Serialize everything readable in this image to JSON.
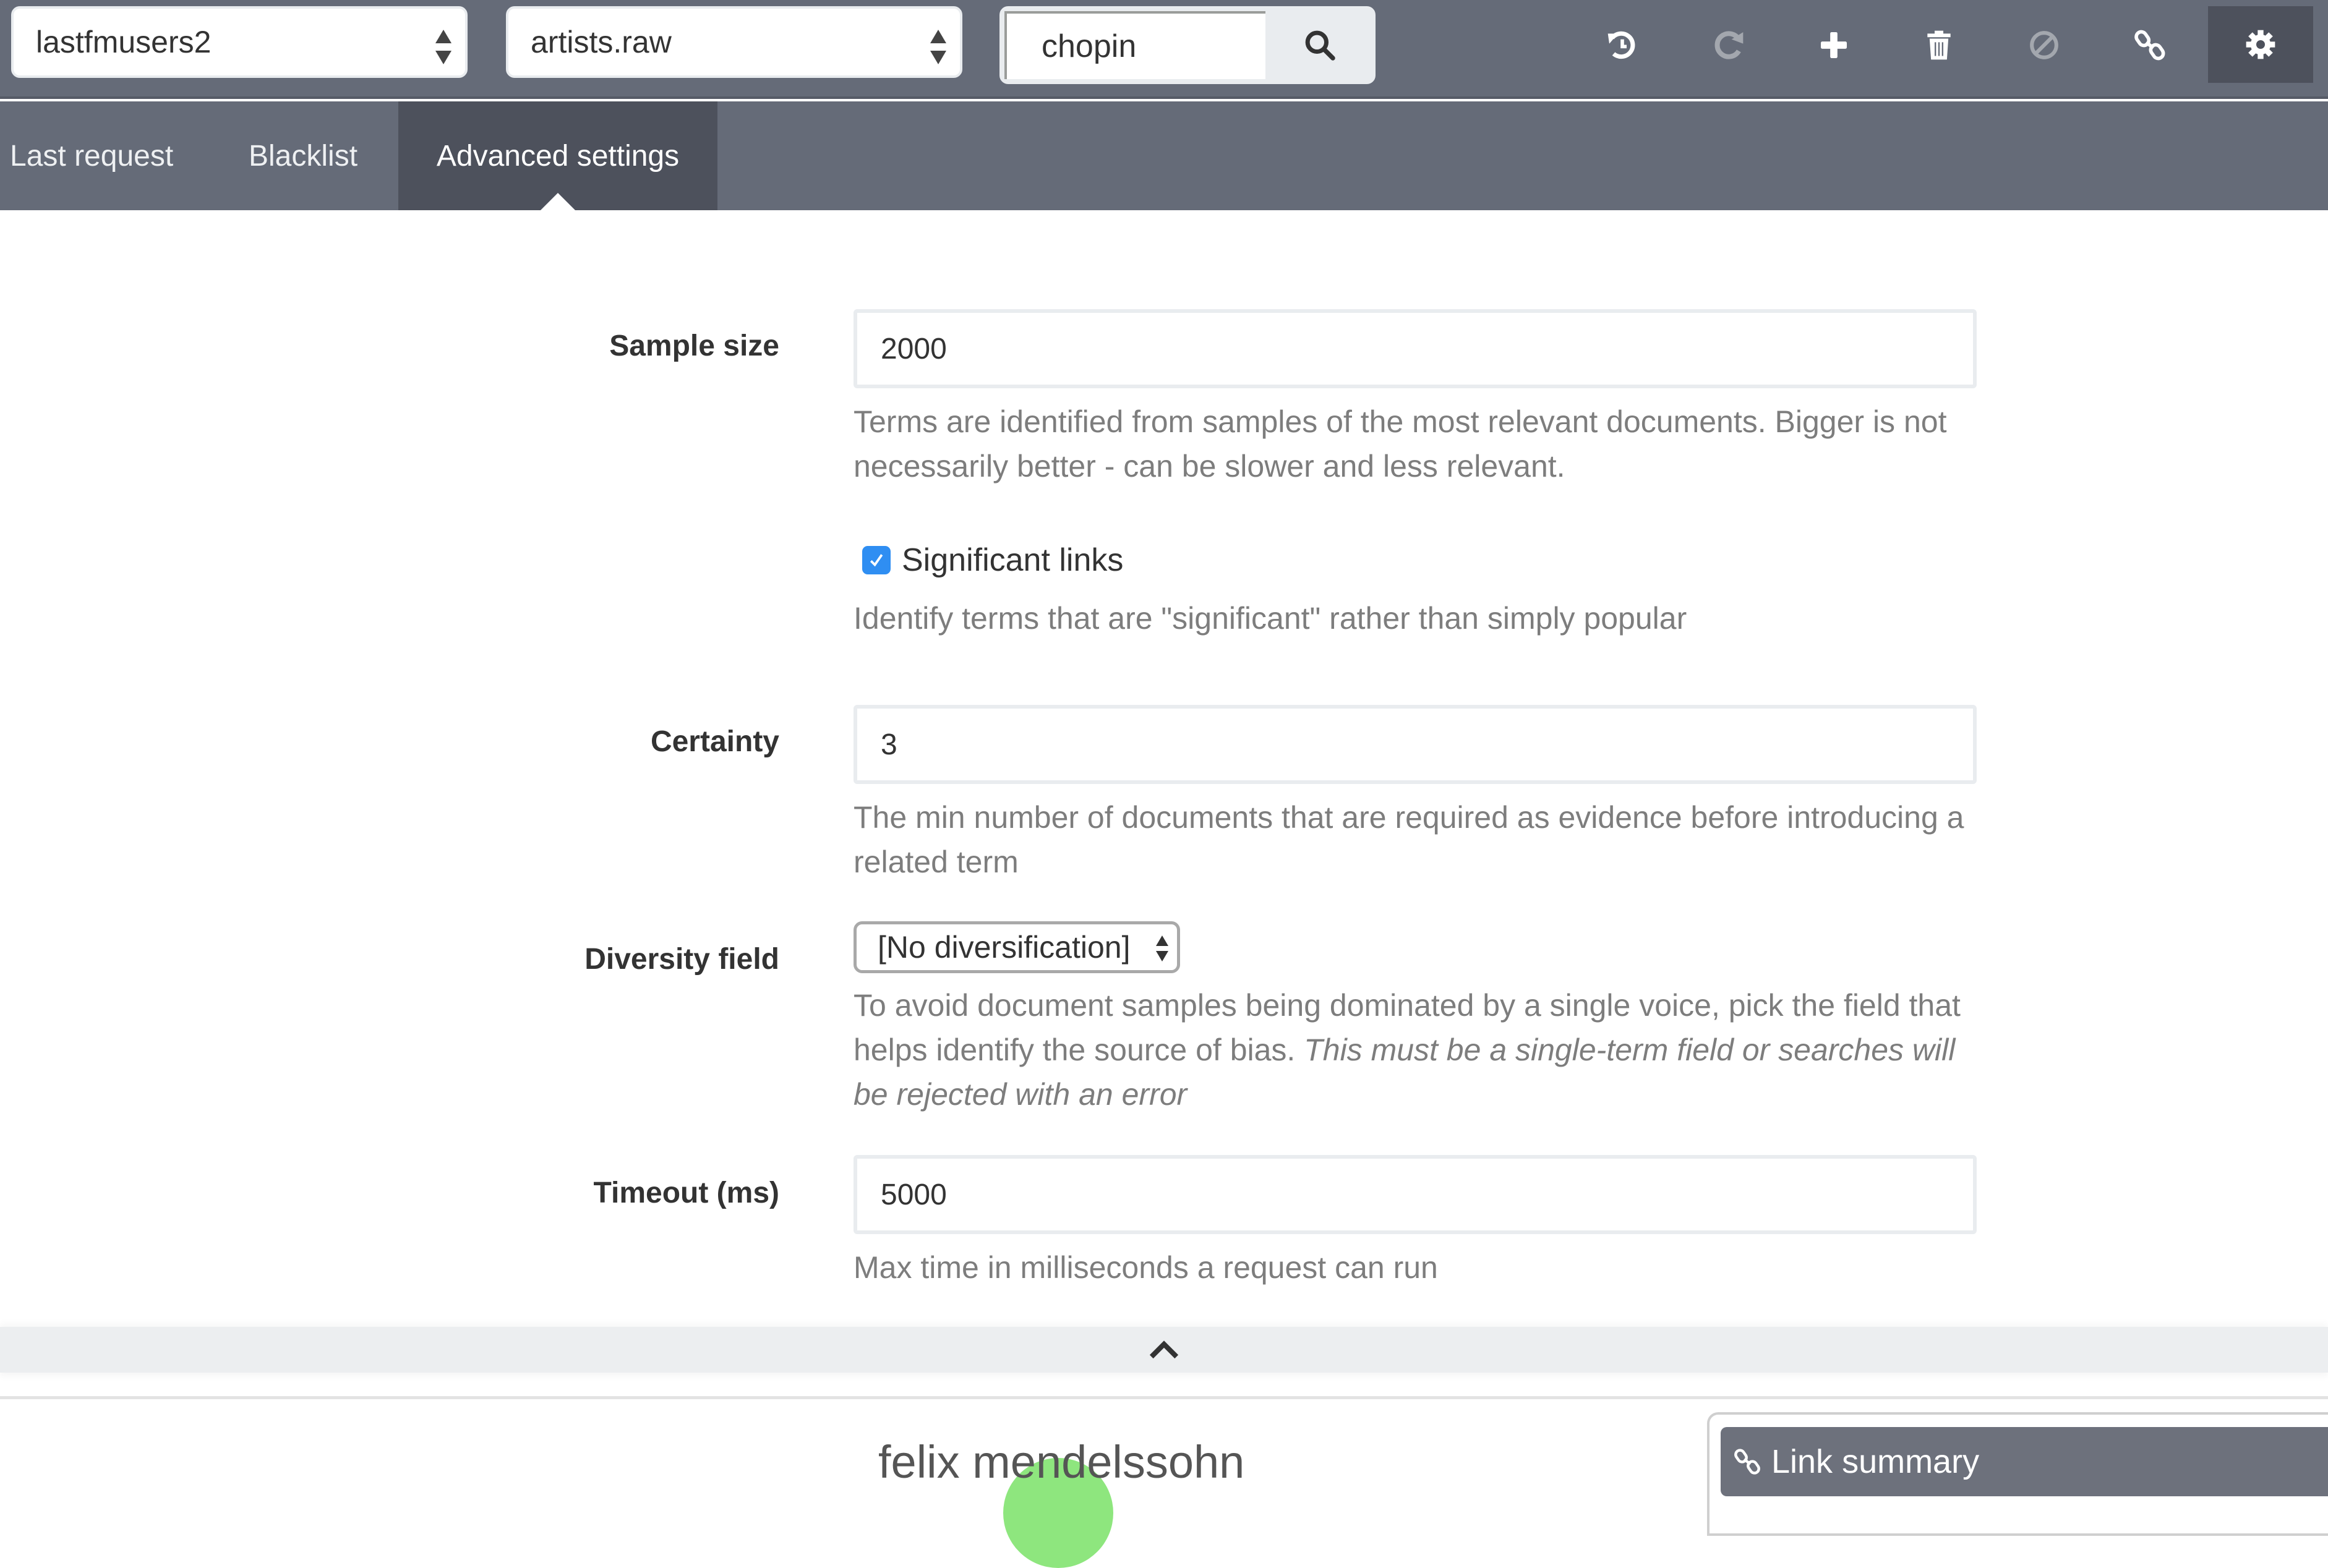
{
  "toolbar": {
    "index_select": {
      "value": "lastfmusers2"
    },
    "field_select": {
      "value": "artists.raw"
    },
    "search": {
      "value": "chopin",
      "icon": "search-icon"
    },
    "actions": [
      {
        "name": "undo",
        "icon": "history-icon",
        "enabled": true
      },
      {
        "name": "redo",
        "icon": "redo-icon",
        "enabled": false
      },
      {
        "name": "add",
        "icon": "plus-icon",
        "enabled": true
      },
      {
        "name": "delete",
        "icon": "trash-icon",
        "enabled": true
      },
      {
        "name": "blacklist",
        "icon": "ban-icon",
        "enabled": false
      },
      {
        "name": "link",
        "icon": "link-icon",
        "enabled": true
      },
      {
        "name": "settings",
        "icon": "gear-icon",
        "enabled": true,
        "active": true
      }
    ]
  },
  "tabs": [
    {
      "label": "Last request",
      "active": false
    },
    {
      "label": "Blacklist",
      "active": false
    },
    {
      "label": "Advanced settings",
      "active": true
    }
  ],
  "settings": {
    "sample_size": {
      "label": "Sample size",
      "value": "2000",
      "help": "Terms are identified from samples of the most relevant documents. Bigger is not necessarily better - can be slower and less relevant."
    },
    "significant_links": {
      "label": "Significant links",
      "checked": true,
      "help": "Identify terms that are \"significant\" rather than simply popular"
    },
    "certainty": {
      "label": "Certainty",
      "value": "3",
      "help": "The min number of documents that are required as evidence before introducing a related term"
    },
    "diversity_field": {
      "label": "Diversity field",
      "value": "[No diversification]",
      "help": "To avoid document samples being dominated by a single voice, pick the field that helps identify the source of bias.",
      "help_italic": "This must be a single-term field or searches will be rejected with an error"
    },
    "timeout": {
      "label": "Timeout (ms)",
      "value": "5000",
      "help": "Max time in milliseconds a request can run"
    }
  },
  "collapse": {
    "icon": "chevron-up-icon"
  },
  "graph": {
    "node_label": "felix mendelssohn",
    "node_color": "#8ee67e"
  },
  "link_summary": {
    "title": "Link summary",
    "icon": "link-icon"
  },
  "colors": {
    "toolbar_bg": "#656b78",
    "active_tab_bg": "#4d515c",
    "checkbox_accent": "#2f8ef2"
  }
}
